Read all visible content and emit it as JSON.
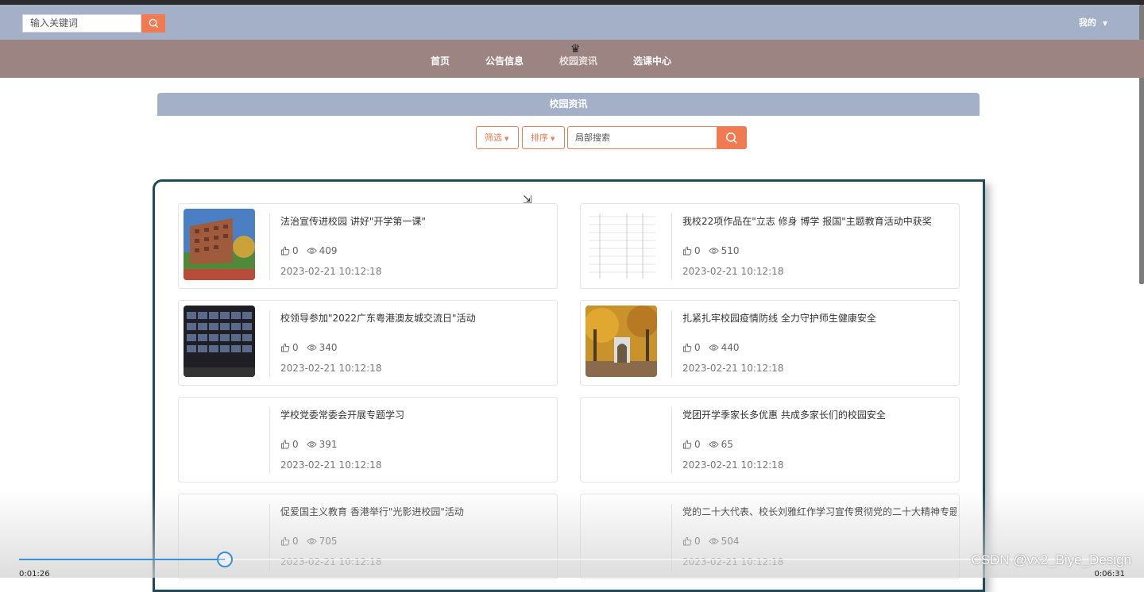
{
  "header": {
    "search_placeholder": "输入关键词",
    "user_menu": "我的"
  },
  "nav": {
    "items": [
      {
        "label": "首页"
      },
      {
        "label": "公告信息"
      },
      {
        "label": "校园资讯"
      },
      {
        "label": "选课中心"
      }
    ],
    "active_index": 2
  },
  "section": {
    "title": "校园资讯",
    "filter_label": "筛选",
    "sort_label": "排序",
    "local_search_placeholder": "局部搜索"
  },
  "cards": [
    {
      "title": "法治宣传进校园 讲好\"开学第一课\"",
      "likes": "0",
      "views": "409",
      "date": "2023-02-21 10:12:18"
    },
    {
      "title": "我校22项作品在\"立志 修身 博学 报国\"主题教育活动中获奖",
      "likes": "0",
      "views": "510",
      "date": "2023-02-21 10:12:18"
    },
    {
      "title": "校领导参加\"2022广东粤港澳友城交流日\"活动",
      "likes": "0",
      "views": "340",
      "date": "2023-02-21 10:12:18"
    },
    {
      "title": "扎紧扎牢校园疫情防线 全力守护师生健康安全",
      "likes": "0",
      "views": "440",
      "date": "2023-02-21 10:12:18"
    },
    {
      "title": "学校党委常委会开展专题学习",
      "likes": "0",
      "views": "391",
      "date": "2023-02-21 10:12:18"
    },
    {
      "title": "党团开学季家长多优惠 共成多家长们的校园安全",
      "likes": "0",
      "views": "65",
      "date": "2023-02-21 10:12:18"
    },
    {
      "title": "促爱国主义教育 香港举行\"光影进校园\"活动",
      "likes": "0",
      "views": "705",
      "date": "2023-02-21 10:12:18"
    },
    {
      "title": "党的二十大代表、校长刘雅红作学习宣传贯彻党的二十大精神专题",
      "likes": "0",
      "views": "504",
      "date": "2023-02-21 10:12:18"
    }
  ],
  "video": {
    "current_time": "0:01:26",
    "total_time": "0:06:31",
    "progress": 0.186,
    "watermark": "CSDN @vx2_Biye_Design"
  },
  "colors": {
    "header_bg": "#a4b0c8",
    "nav_bg": "#9b8482",
    "accent": "#f07a52",
    "panel_border": "#1f4a58"
  }
}
